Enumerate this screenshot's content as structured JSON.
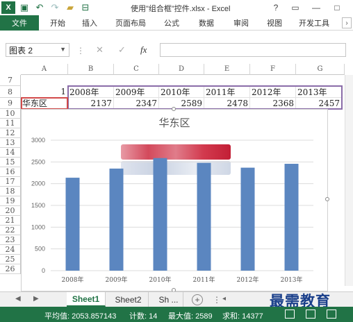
{
  "window": {
    "title": "使用\"组合框\"控件.xlsx - Excel",
    "help": "?",
    "restore": "▭",
    "minimize": "—",
    "maximize": "□"
  },
  "ribbon": {
    "tabs": [
      "文件",
      "开始",
      "插入",
      "页面布局",
      "公式",
      "数据",
      "审阅",
      "视图",
      "开发工具"
    ]
  },
  "formula_bar": {
    "name_box": "图表 2",
    "fx": "fx",
    "value": ""
  },
  "grid": {
    "columns": [
      "A",
      "B",
      "C",
      "D",
      "E",
      "F",
      "G"
    ],
    "rows": [
      "7",
      "8",
      "9",
      "10",
      "11",
      "12",
      "13",
      "14",
      "15",
      "16",
      "17",
      "18",
      "19",
      "20",
      "21",
      "22",
      "23",
      "24",
      "25",
      "26"
    ],
    "row8": [
      "1",
      "2008年",
      "2009年",
      "2010年",
      "2011年",
      "2012年",
      "2013年"
    ],
    "row9": [
      "华东区",
      "2137",
      "2347",
      "2589",
      "2478",
      "2368",
      "2457"
    ]
  },
  "chart_data": {
    "type": "bar",
    "title": "华东区",
    "categories": [
      "2008年",
      "2009年",
      "2010年",
      "2011年",
      "2012年",
      "2013年"
    ],
    "values": [
      2137,
      2347,
      2589,
      2478,
      2368,
      2457
    ],
    "ylim": [
      0,
      3000
    ],
    "yticks": [
      "0",
      "500",
      "1000",
      "1500",
      "2000",
      "2500",
      "3000"
    ],
    "grid": true,
    "color": "#5b86c0"
  },
  "sheets": {
    "tabs": [
      "Sheet1",
      "Sheet2",
      "Sh ..."
    ],
    "active": "Sheet1",
    "add": "+"
  },
  "watermark": "最需教育",
  "status": {
    "average": "平均值: 2053.857143",
    "count": "计数: 14",
    "max": "最大值: 2589",
    "sum": "求和: 14377"
  }
}
